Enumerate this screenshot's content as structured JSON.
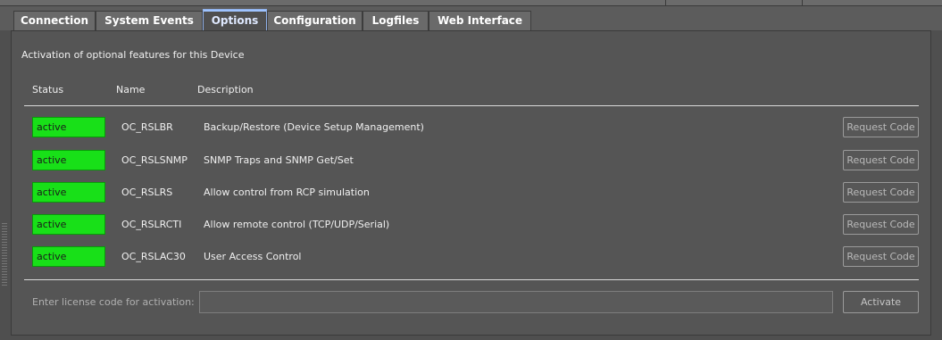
{
  "tabs": [
    {
      "label": "Connection"
    },
    {
      "label": "System Events"
    },
    {
      "label": "Options"
    },
    {
      "label": "Configuration"
    },
    {
      "label": "Logfiles"
    },
    {
      "label": "Web Interface"
    }
  ],
  "active_tab": "Options",
  "options": {
    "heading": "Activation of optional features for this Device",
    "columns": {
      "status": "Status",
      "name": "Name",
      "description": "Description"
    },
    "rows": [
      {
        "status": "active",
        "name": "OC_RSLBR",
        "description": "Backup/Restore (Device Setup Management)",
        "button": "Request Code"
      },
      {
        "status": "active",
        "name": "OC_RSLSNMP",
        "description": "SNMP Traps and SNMP Get/Set",
        "button": "Request Code"
      },
      {
        "status": "active",
        "name": "OC_RSLRS",
        "description": "Allow control from RCP simulation",
        "button": "Request Code"
      },
      {
        "status": "active",
        "name": "OC_RSLRCTI",
        "description": "Allow remote control (TCP/UDP/Serial)",
        "button": "Request Code"
      },
      {
        "status": "active",
        "name": "OC_RSLAC30",
        "description": "User Access Control",
        "button": "Request Code"
      }
    ],
    "license_label": "Enter license code for activation:",
    "license_value": "",
    "activate_label": "Activate"
  },
  "colors": {
    "active_status": "#18e018",
    "panel": "#555555",
    "active_tab_border": "#8fb0e8"
  }
}
